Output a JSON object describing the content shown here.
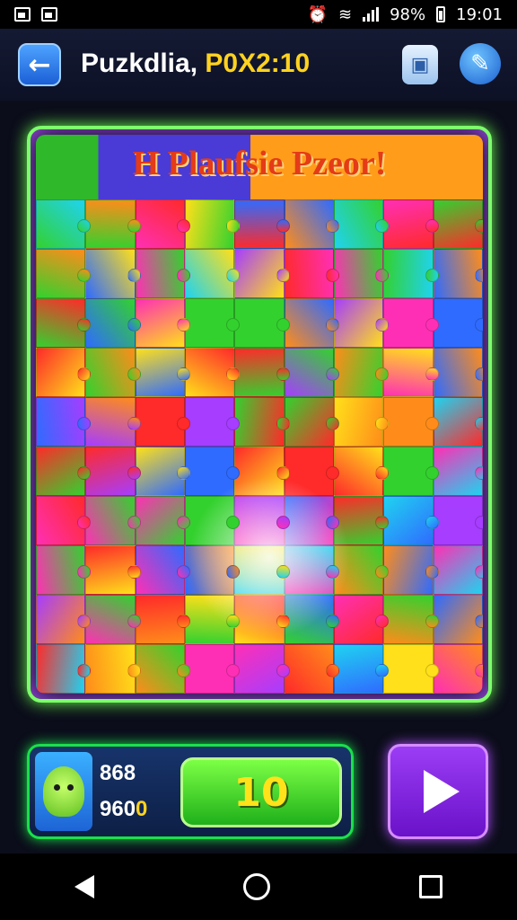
{
  "status_bar": {
    "battery": "98%",
    "time": "19:01"
  },
  "header": {
    "title": "Puzkdlia,",
    "timer": "P0X2:10",
    "back_icon": "arrow-left-icon",
    "shop_icon": "bag-icon",
    "edit_icon": "pencil-icon"
  },
  "board": {
    "banner_text": "H Plaufsie Pzeor!",
    "columns": 9,
    "rows": 10,
    "colors": [
      "#ff2a2a",
      "#ff8c1a",
      "#ffe01a",
      "#33d12e",
      "#1fd3f0",
      "#2f6bff",
      "#a63dff",
      "#ff2fb5"
    ]
  },
  "player": {
    "score_top": "868",
    "score_bottom_prefix": "960",
    "score_bottom_accent": "0",
    "level": "10"
  },
  "controls": {
    "play_icon": "play-icon"
  },
  "nav": {
    "back_icon": "nav-back-icon",
    "home_icon": "nav-home-icon",
    "recent_icon": "nav-recent-icon"
  }
}
